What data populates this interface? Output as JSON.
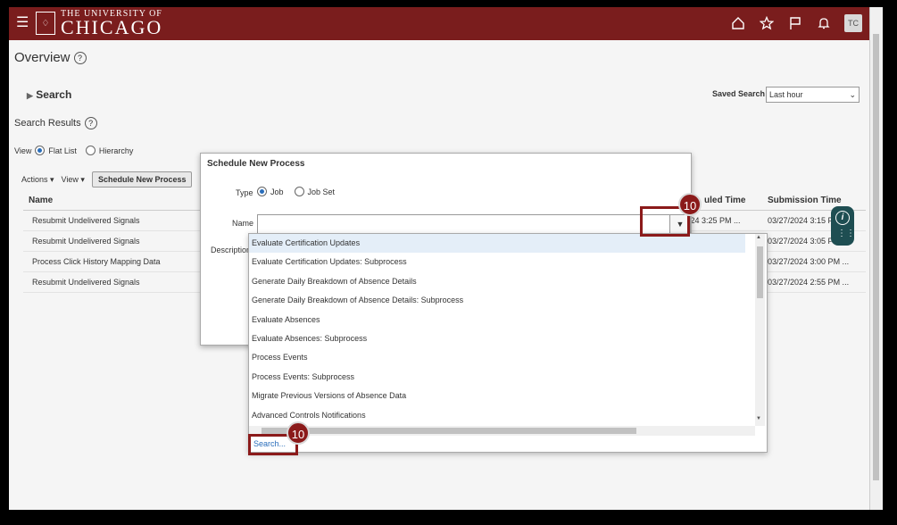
{
  "header": {
    "logo_line1": "THE UNIVERSITY OF",
    "logo_line2": "CHICAGO",
    "avatar_initials": "TC",
    "brand_color": "#7a1d1d"
  },
  "page": {
    "title": "Overview",
    "search_label": "Search",
    "saved_search_label": "Saved Search",
    "saved_search_value": "Last hour",
    "results_title": "Search Results"
  },
  "view_options": {
    "label": "View",
    "flat_list": "Flat List",
    "hierarchy": "Hierarchy"
  },
  "toolbar": {
    "actions": "Actions",
    "view": "View",
    "schedule": "Schedule New Process"
  },
  "table": {
    "headers": [
      "Name",
      "uled Time",
      "Submission Time"
    ],
    "rows": [
      {
        "name": "Resubmit Undelivered Signals",
        "scheduled": "/2024 3:25 PM ...",
        "submitted": "03/27/2024 3:15 P"
      },
      {
        "name": "Resubmit Undelivered Signals",
        "scheduled": "",
        "submitted": "03/27/2024 3:05 P"
      },
      {
        "name": "Process Click History Mapping Data",
        "scheduled": "",
        "submitted": "03/27/2024 3:00 PM ..."
      },
      {
        "name": "Resubmit Undelivered Signals",
        "scheduled": "",
        "submitted": "03/27/2024 2:55 PM ..."
      }
    ]
  },
  "dialog": {
    "title": "Schedule New Process",
    "type_label": "Type",
    "type_job": "Job",
    "type_jobset": "Job Set",
    "name_label": "Name",
    "description_label": "Description"
  },
  "dropdown": {
    "items": [
      "Evaluate Certification Updates",
      "Evaluate Certification Updates: Subprocess",
      "Generate Daily Breakdown of Absence Details",
      "Generate Daily Breakdown of Absence Details: Subprocess",
      "Evaluate Absences",
      "Evaluate Absences: Subprocess",
      "Process Events",
      "Process Events: Subprocess",
      "Migrate Previous Versions of Absence Data",
      "Advanced Controls Notifications"
    ],
    "search_link": "Search..."
  },
  "callouts": {
    "first": "10",
    "second": "10"
  }
}
